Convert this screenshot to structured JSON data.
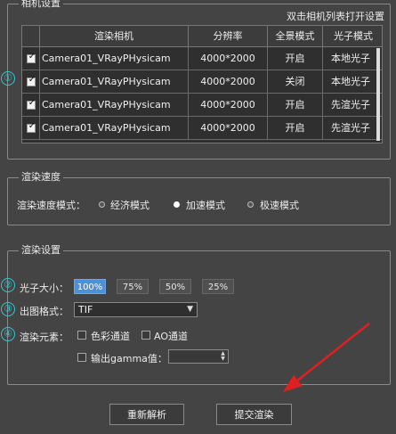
{
  "camera_section": {
    "title": "相机设置",
    "hint": "双击相机列表打开设置",
    "columns": [
      "渲染相机",
      "分辨率",
      "全景模式",
      "光子模式"
    ],
    "rows": [
      {
        "checked": true,
        "camera": "Camera01_VRayPHysicam",
        "resolution": "4000*2000",
        "panorama": "开启",
        "photon": "本地光子"
      },
      {
        "checked": true,
        "camera": "Camera01_VRayPHysicam",
        "resolution": "4000*2000",
        "panorama": "关闭",
        "photon": "本地光子"
      },
      {
        "checked": true,
        "camera": "Camera01_VRayPHysicam",
        "resolution": "4000*2000",
        "panorama": "开启",
        "photon": "先渲光子"
      },
      {
        "checked": true,
        "camera": "Camera01_VRayPHysicam",
        "resolution": "4000*2000",
        "panorama": "开启",
        "photon": "先渲光子"
      }
    ],
    "marker": "①"
  },
  "speed_section": {
    "title": "渲染速度",
    "mode_label": "渲染速度模式：",
    "options": [
      "经济模式",
      "加速模式",
      "极速模式"
    ],
    "selected": "加速模式"
  },
  "render_section": {
    "title": "渲染设置",
    "photon_size": {
      "marker": "②",
      "label": "光子大小：",
      "options": [
        "100%",
        "75%",
        "50%",
        "25%"
      ],
      "selected": "100%"
    },
    "output_format": {
      "marker": "③",
      "label": "出图格式：",
      "value": "TIF"
    },
    "elements": {
      "marker": "④",
      "label": "渲染元素：",
      "color_channel": "色彩通道",
      "ao_channel": "AO通道",
      "gamma_label": "输出gamma值：",
      "gamma_value": ""
    }
  },
  "buttons": {
    "reparse": "重新解析",
    "submit": "提交渲染"
  },
  "colors": {
    "accent_blue": "#4f8fd6",
    "marker_cyan": "#34c7cf",
    "arrow_red": "#e02020"
  },
  "icons": {
    "dropdown": "chevron-down-icon",
    "spinner": "spinner-arrows-icon",
    "annotation": "red-arrow-icon"
  }
}
